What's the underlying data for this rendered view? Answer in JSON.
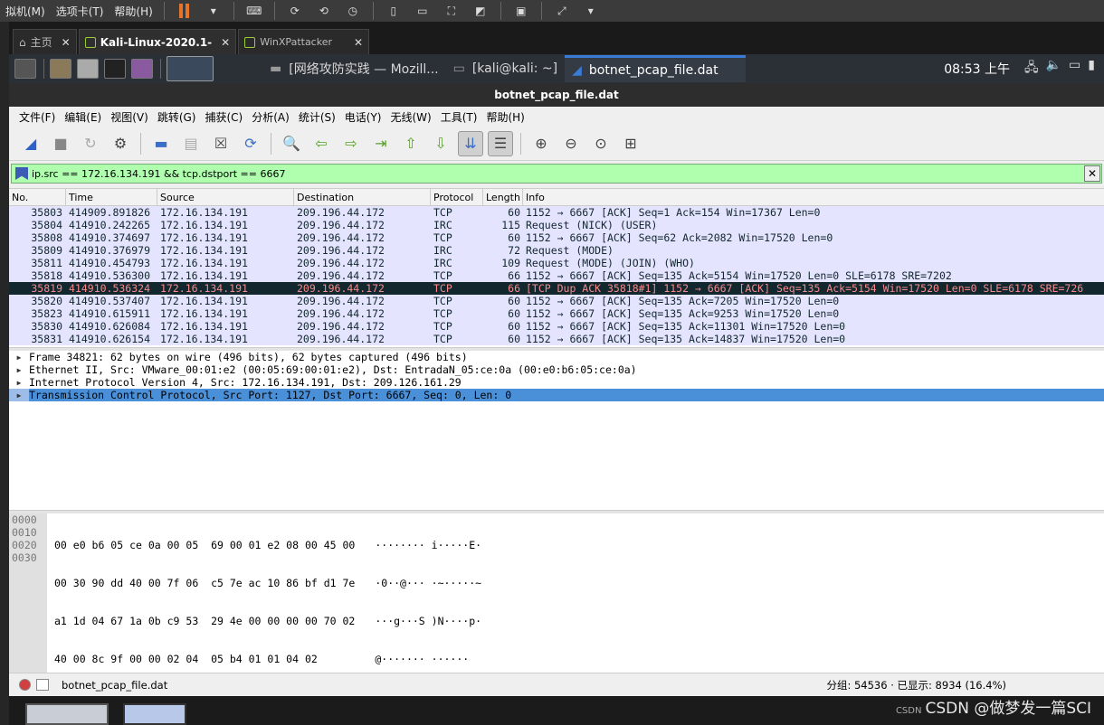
{
  "vm_menubar": {
    "items": [
      "拟机(M)",
      "选项卡(T)",
      "帮助(H)"
    ]
  },
  "vm_tabs": [
    {
      "label": "主页",
      "close": "✕"
    },
    {
      "label": "Kali-Linux-2020.1-",
      "close": "✕"
    },
    {
      "label": "WinXPattacker",
      "close": "✕"
    }
  ],
  "panel": {
    "tasks": [
      "[网络攻防实践 — Mozill...",
      "[kali@kali: ~]",
      "botnet_pcap_file.dat"
    ],
    "clock": "08:53 上午"
  },
  "window": {
    "title": "botnet_pcap_file.dat"
  },
  "menu": [
    "文件(F)",
    "编辑(E)",
    "视图(V)",
    "跳转(G)",
    "捕获(C)",
    "分析(A)",
    "统计(S)",
    "电话(Y)",
    "无线(W)",
    "工具(T)",
    "帮助(H)"
  ],
  "filter": {
    "value": "ip.src == 172.16.134.191 && tcp.dstport == 6667",
    "clear": "✕"
  },
  "columns": [
    "No.",
    "Time",
    "Source",
    "Destination",
    "Protocol",
    "Length",
    "Info"
  ],
  "packets": [
    {
      "no": "35803",
      "time": "414909.891826",
      "src": "172.16.134.191",
      "dst": "209.196.44.172",
      "proto": "TCP",
      "len": "60",
      "info": "1152 → 6667 [ACK] Seq=1 Ack=154 Win=17367 Len=0"
    },
    {
      "no": "35804",
      "time": "414910.242265",
      "src": "172.16.134.191",
      "dst": "209.196.44.172",
      "proto": "IRC",
      "len": "115",
      "info": "Request (NICK) (USER)"
    },
    {
      "no": "35808",
      "time": "414910.374697",
      "src": "172.16.134.191",
      "dst": "209.196.44.172",
      "proto": "TCP",
      "len": "60",
      "info": "1152 → 6667 [ACK] Seq=62 Ack=2082 Win=17520 Len=0"
    },
    {
      "no": "35809",
      "time": "414910.376979",
      "src": "172.16.134.191",
      "dst": "209.196.44.172",
      "proto": "IRC",
      "len": "72",
      "info": "Request (MODE)"
    },
    {
      "no": "35811",
      "time": "414910.454793",
      "src": "172.16.134.191",
      "dst": "209.196.44.172",
      "proto": "IRC",
      "len": "109",
      "info": "Request (MODE) (JOIN) (WHO)"
    },
    {
      "no": "35818",
      "time": "414910.536300",
      "src": "172.16.134.191",
      "dst": "209.196.44.172",
      "proto": "TCP",
      "len": "66",
      "info": "1152 → 6667 [ACK] Seq=135 Ack=5154 Win=17520 Len=0 SLE=6178 SRE=7202"
    },
    {
      "no": "35819",
      "time": "414910.536324",
      "src": "172.16.134.191",
      "dst": "209.196.44.172",
      "proto": "TCP",
      "len": "66",
      "info": "[TCP Dup ACK 35818#1] 1152 → 6667 [ACK] Seq=135 Ack=5154 Win=17520 Len=0 SLE=6178 SRE=726"
    },
    {
      "no": "35820",
      "time": "414910.537407",
      "src": "172.16.134.191",
      "dst": "209.196.44.172",
      "proto": "TCP",
      "len": "60",
      "info": "1152 → 6667 [ACK] Seq=135 Ack=7205 Win=17520 Len=0"
    },
    {
      "no": "35823",
      "time": "414910.615911",
      "src": "172.16.134.191",
      "dst": "209.196.44.172",
      "proto": "TCP",
      "len": "60",
      "info": "1152 → 6667 [ACK] Seq=135 Ack=9253 Win=17520 Len=0"
    },
    {
      "no": "35830",
      "time": "414910.626084",
      "src": "172.16.134.191",
      "dst": "209.196.44.172",
      "proto": "TCP",
      "len": "60",
      "info": "1152 → 6667 [ACK] Seq=135 Ack=11301 Win=17520 Len=0"
    },
    {
      "no": "35831",
      "time": "414910.626154",
      "src": "172.16.134.191",
      "dst": "209.196.44.172",
      "proto": "TCP",
      "len": "60",
      "info": "1152 → 6667 [ACK] Seq=135 Ack=14837 Win=17520 Len=0"
    }
  ],
  "selected_packet_no": "35819",
  "details": [
    "Frame 34821: 62 bytes on wire (496 bits), 62 bytes captured (496 bits)",
    "Ethernet II, Src: VMware_00:01:e2 (00:05:69:00:01:e2), Dst: EntradaN_05:ce:0a (00:e0:b6:05:ce:0a)",
    "Internet Protocol Version 4, Src: 172.16.134.191, Dst: 209.126.161.29",
    "Transmission Control Protocol, Src Port: 1127, Dst Port: 6667, Seq: 0, Len: 0"
  ],
  "bytes": [
    {
      "off": "0000",
      "hex": "00 e0 b6 05 ce 0a 00 05  69 00 01 e2 08 00 45 00",
      "ascii": "········ i·····E·"
    },
    {
      "off": "0010",
      "hex": "00 30 90 dd 40 00 7f 06  c5 7e ac 10 86 bf d1 7e",
      "ascii": "·0··@··· ·~·····~"
    },
    {
      "off": "0020",
      "hex": "a1 1d 04 67 1a 0b c9 53  29 4e 00 00 00 00 70 02",
      "ascii": "···g···S )N····p·"
    },
    {
      "off": "0030",
      "hex": "40 00 8c 9f 00 00 02 04  05 b4 01 01 04 02",
      "ascii": "@······· ······"
    }
  ],
  "status": {
    "file": "botnet_pcap_file.dat",
    "stats": "分组: 54536 · 已显示: 8934 (16.4%)"
  },
  "watermark": {
    "small": "CSDN",
    "text": "CSDN @做梦发一篇SCI"
  }
}
